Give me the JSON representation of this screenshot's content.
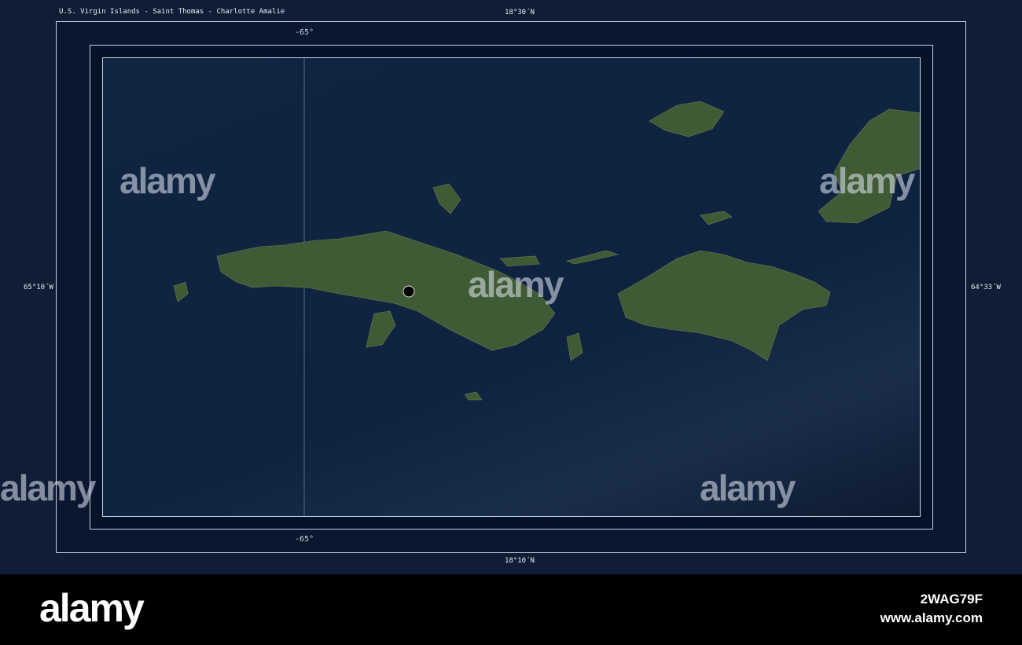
{
  "map": {
    "title": "U.S. Virgin Islands - Saint Thomas - Charlotte Amalie",
    "lat_top": "18°30´N",
    "lat_bottom": "18°10´N",
    "lon_left": "65°10´W",
    "lon_right": "64°33´W",
    "meridian_top": "-65°",
    "meridian_bottom": "-65°",
    "marker": "Charlotte Amalie",
    "colors": {
      "ocean": "#0f1e36",
      "land": "#3f5a34",
      "marker": "#000000"
    }
  },
  "watermark": {
    "text": "alamy",
    "letter": "a"
  },
  "footer": {
    "logo": "alamy",
    "image_id": "2WAG79F",
    "url": "www.alamy.com"
  }
}
